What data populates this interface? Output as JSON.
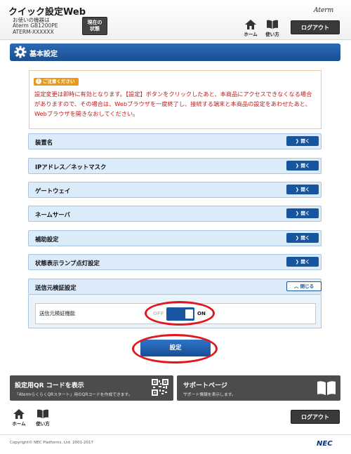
{
  "header": {
    "app_title": "クイック設定Web",
    "device_caption": "お使いの機器は",
    "device_model": "Aterm GB1200PE",
    "device_id": "ATERM-XXXXXX",
    "status_button_line1": "現在の",
    "status_button_line2": "状態",
    "home_label": "ホーム",
    "help_label": "使い方",
    "logout_label": "ログアウト",
    "brand": "Aterm"
  },
  "section": {
    "title": "基本設定"
  },
  "caution": {
    "badge": "ご注意ください",
    "text": "設定変更は即時に有効となります。【設定】ボタンをクリックしたあと、本商品にアクセスできなくなる場合がありますので、その場合は、Webブラウザを一度終了し、接続する端末と本商品の設定をあわせたあと、Webブラウザを開きなおしてください。"
  },
  "accordion": {
    "open_label": "開く",
    "close_label": "閉じる",
    "items": [
      {
        "label": "装置名"
      },
      {
        "label": "IPアドレス／ネットマスク"
      },
      {
        "label": "ゲートウェイ"
      },
      {
        "label": "ネームサーバ"
      },
      {
        "label": "補助設定"
      },
      {
        "label": "状態表示ランプ点灯設定"
      },
      {
        "label": "送信元検証設定"
      }
    ]
  },
  "source_verification": {
    "label": "送信元検証機能",
    "off_label": "OFF",
    "on_label": "ON",
    "state": "on"
  },
  "setting_button": "設定",
  "panels": {
    "qr_title": "設定用QR コードを表示",
    "qr_sub": "「AtermらくらくQRスタート」用のQRコードを作成できます。",
    "support_title": "サポートページ",
    "support_sub": "サポート情報を表示します。"
  },
  "footer": {
    "home_label": "ホーム",
    "help_label": "使い方",
    "logout_label": "ログアウト",
    "copyright": "Copyright© NEC Platforms, Ltd. 2001-2017",
    "brand": "NEC"
  },
  "colors": {
    "primary_blue": "#1a4f92",
    "caution_red": "#c41818",
    "highlight_ring": "#e2161c"
  }
}
